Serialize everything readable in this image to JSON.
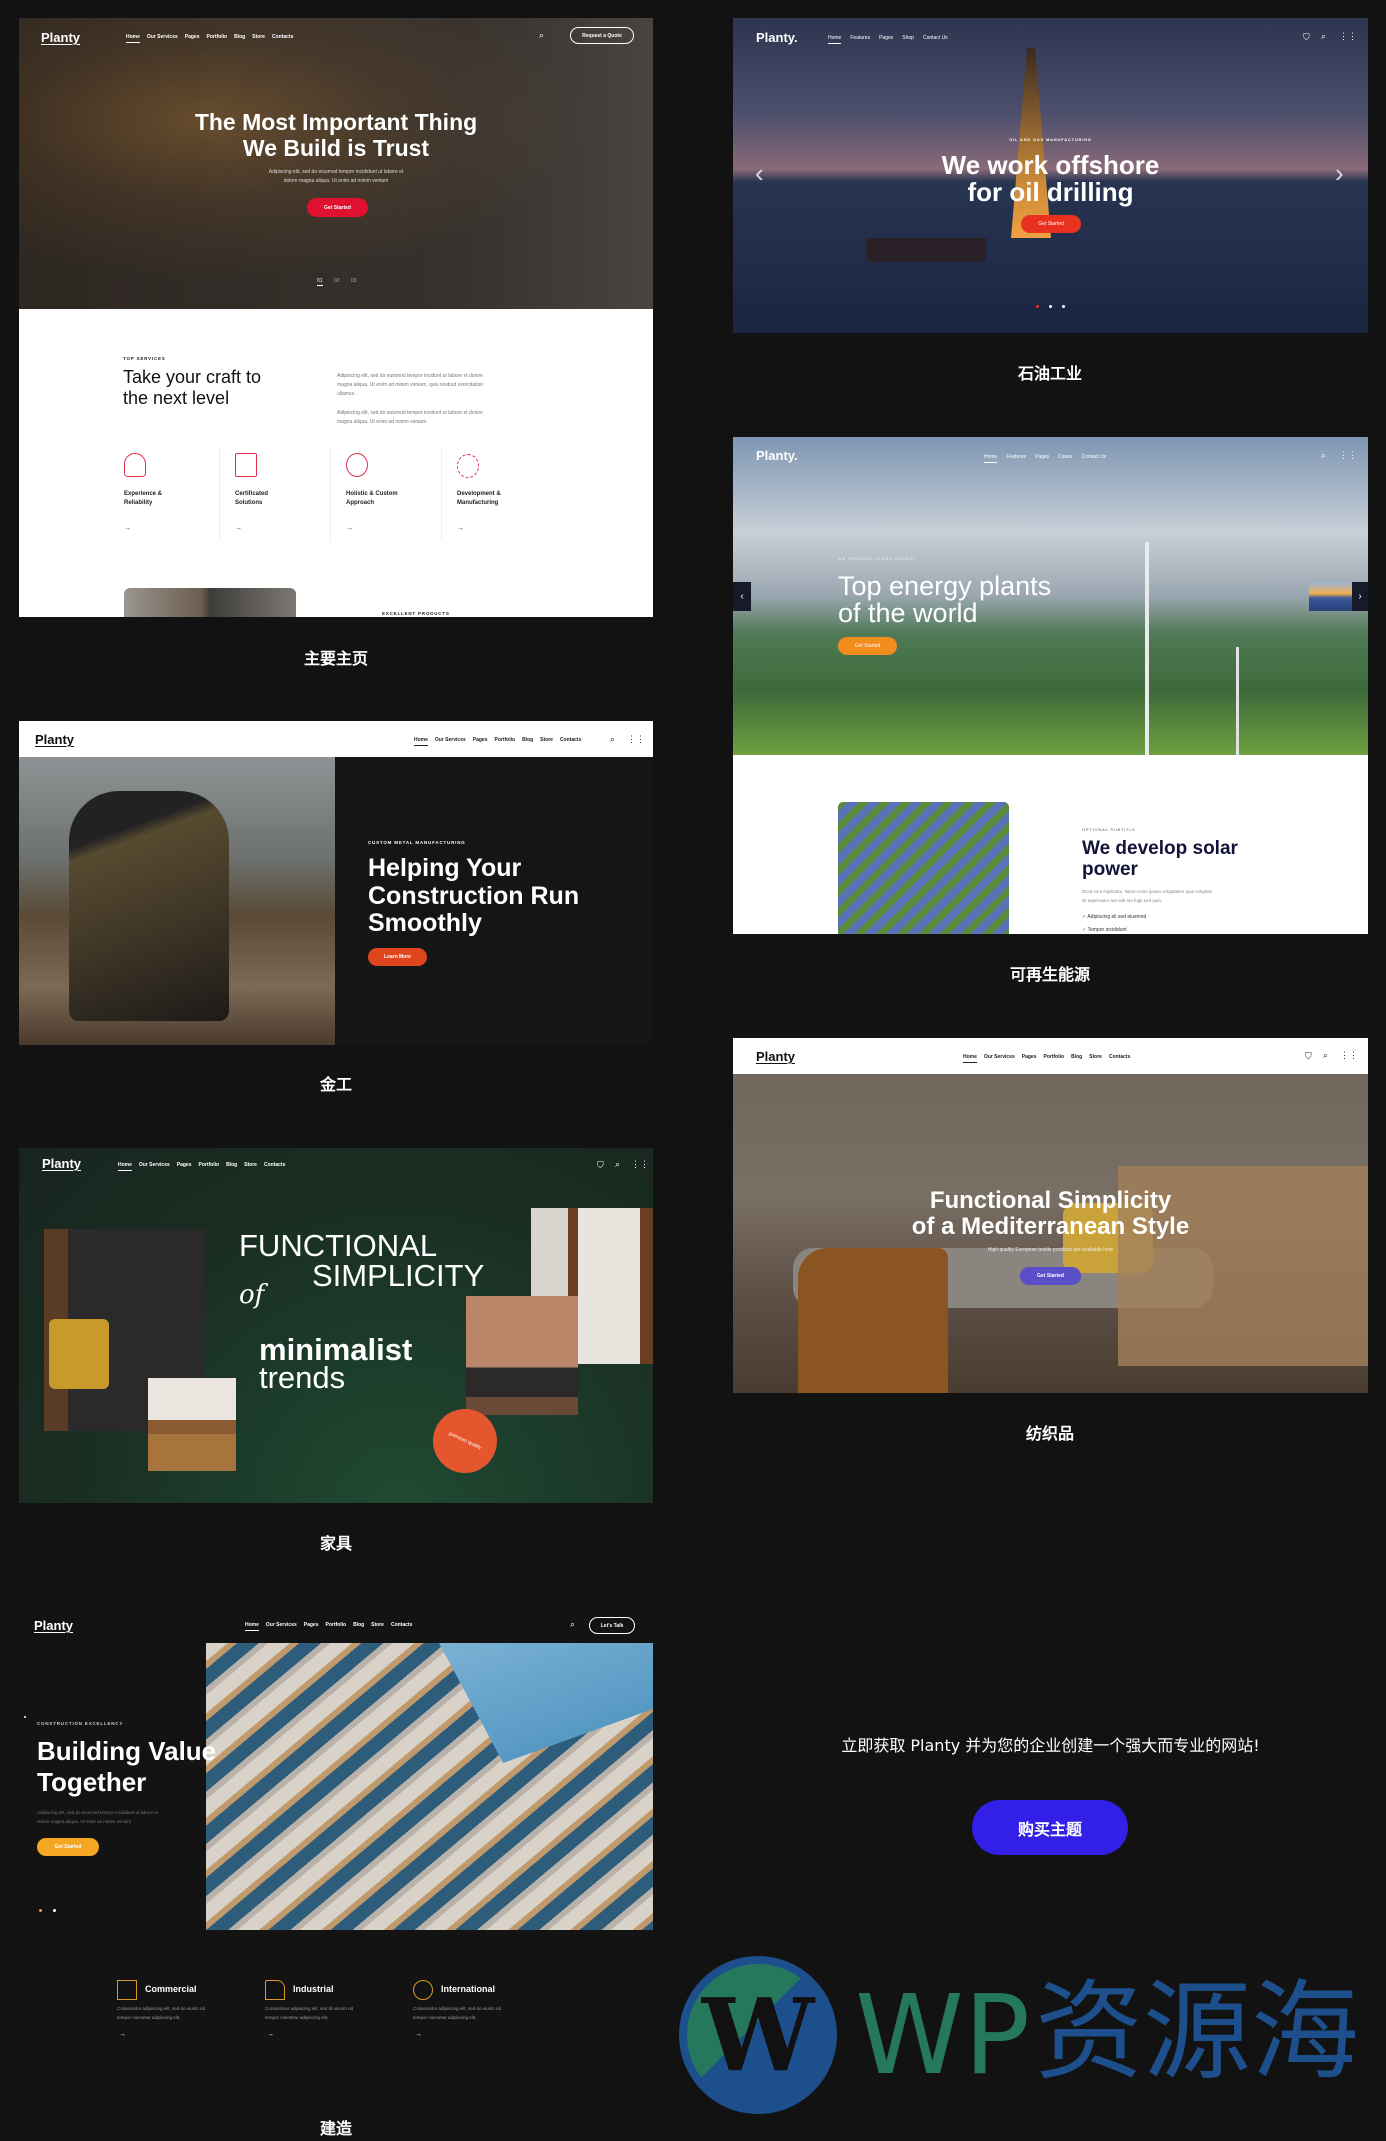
{
  "labels": {
    "main_home": "主要主页",
    "oil": "石油工业",
    "renewable": "可再生能源",
    "metal": "金工",
    "textile": "纺织品",
    "furniture": "家具",
    "construction": "建造"
  },
  "main": {
    "logo": "Planty",
    "nav": [
      "Home",
      "Our Services",
      "Pages",
      "Portfolio",
      "Blog",
      "Store",
      "Contacts"
    ],
    "quote_button": "Request a Quote",
    "title_line1": "The Most Important Thing",
    "title_line2": "We Build is Trust",
    "subtitle_line1": "Adipiscing elit, sed do eiusmod tempor incididunt ut labore et",
    "subtitle_line2": "dolore magna aliqua. Ut enim ad minim veniam",
    "cta": "Get Started",
    "slides": [
      "01",
      "02",
      "03"
    ],
    "accent": "#e0102f",
    "services": {
      "eyebrow": "TOP SERVICES",
      "heading_line1": "Take your craft to",
      "heading_line2": "the next level",
      "para1": [
        "Adipiscing elit, sed do euismod tempor incidunt ut labore et dolore",
        "magna aliqua. Ut enim ad minim veniam, quis nostrud exercitation",
        "ullamco."
      ],
      "para2": [
        "Adipiscing elit, sed do euismod tempor incidunt ut labore et dolore",
        "magna aliqua. Ut enim ad minim veniam."
      ],
      "items": [
        {
          "line1": "Experience &",
          "line2": "Reliability",
          "icon": "hand-shield-icon"
        },
        {
          "line1": "Certificated",
          "line2": "Solutions",
          "icon": "certificate-icon"
        },
        {
          "line1": "Holistic & Custom",
          "line2": "Approach",
          "icon": "network-icon"
        },
        {
          "line1": "Development &",
          "line2": "Manufacturing",
          "icon": "gear-icon"
        }
      ],
      "arrow": "→",
      "products_eyebrow": "EXCELLENT PRODUCTS"
    }
  },
  "oil": {
    "logo": "Planty.",
    "nav": [
      "Home",
      "Features",
      "Pages",
      "Shop",
      "Contact Us"
    ],
    "eyebrow": "OIL AND GAS MANUFACTURING",
    "title_line1": "We work offshore",
    "title_line2": "for oil drilling",
    "cta": "Get Started",
    "prev": "‹",
    "next": "›",
    "accent": "#e8311f"
  },
  "renewable": {
    "logo": "Planty.",
    "nav": [
      "Home",
      "Features",
      "Pages",
      "Cases",
      "Contact Us"
    ],
    "eyebrow": "WE PRODUCE CLEAN ENERGY",
    "title_line1": "Top energy plants",
    "title_line2": "of the world",
    "cta": "Get Started",
    "prev": "‹",
    "next": "›",
    "accent": "#f28c1c",
    "subtitle": "OPTIONAL SUBTITLE",
    "heading_line1": "We develop solar",
    "heading_line2": "power",
    "para": [
      "Dicta sunt explicabo. Nemo enim ipsam voluptatem quia voluptas",
      "sit aspernatur aut odit aut fugit sed quia."
    ],
    "checks": [
      "Adipiscing eli sed eiusmod",
      "Tempor incididunt"
    ],
    "check": "✓"
  },
  "metal": {
    "logo": "Planty",
    "nav": [
      "Home",
      "Our Services",
      "Pages",
      "Portfolio",
      "Blog",
      "Store",
      "Contacts"
    ],
    "eyebrow": "CUSTOM METAL MANUFACTURING",
    "title_lines": [
      "Helping Your",
      "Construction Run",
      "Smoothly"
    ],
    "cta": "Learn More",
    "accent": "#e0461e"
  },
  "textile": {
    "logo": "Planty",
    "nav": [
      "Home",
      "Our Services",
      "Pages",
      "Portfolio",
      "Blog",
      "Store",
      "Contacts"
    ],
    "title_line1": "Functional Simplicity",
    "title_line2": "of a Mediterranean Style",
    "subtitle": "High quality European textile products are available here",
    "cta": "Get Started",
    "accent": "#5a4fc8"
  },
  "furniture": {
    "logo": "Planty",
    "nav": [
      "Home",
      "Our Services",
      "Pages",
      "Portfolio",
      "Blog",
      "Store",
      "Contacts"
    ],
    "word1": "FUNCTIONAL",
    "word2": "SIMPLICITY",
    "word3": "of",
    "word4": "minimalist",
    "word5": "trends",
    "badge": "premium quality",
    "accent": "#e4572e"
  },
  "construction": {
    "logo": "Planty",
    "nav": [
      "Home",
      "Our Services",
      "Pages",
      "Portfolio",
      "Blog",
      "Store",
      "Contacts"
    ],
    "talk_button": "Let's Talk",
    "eyebrow": "CONSTRUCTION EXCELLENCY",
    "title_line1": "Building Value",
    "title_line2": "Together",
    "para_line1": "Adipiscing elit, sed do eiusmod tempor incididunt ut labore et",
    "para_line2": "dolore magna aliqua. Ut enim ad minim veniam",
    "cta": "Get Started",
    "accent": "#f5a623",
    "features": [
      {
        "name": "Commercial",
        "icon": "buildings-icon",
        "line1": "Consectetur adipiscing elit, sed do eiusm od",
        "line2": "tempor nsectetur adipiscing elit."
      },
      {
        "name": "Industrial",
        "icon": "factory-icon",
        "line1": "Consectetur adipiscing elit, sed do eiusm od",
        "line2": "tempor nsectetur adipiscing elit."
      },
      {
        "name": "International",
        "icon": "globe-network-icon",
        "line1": "Consectetur adipiscing elit, sed do eiusm od",
        "line2": "tempor nsectetur adipiscing elit."
      }
    ],
    "arrow": "→"
  },
  "cta": {
    "text": "立即获取 Planty 并为您的企业创建一个强大而专业的网站!",
    "button": "购买主题",
    "button_color": "#3320e6"
  },
  "watermark": {
    "text_latin": "WP",
    "text_cn": "资源海"
  }
}
